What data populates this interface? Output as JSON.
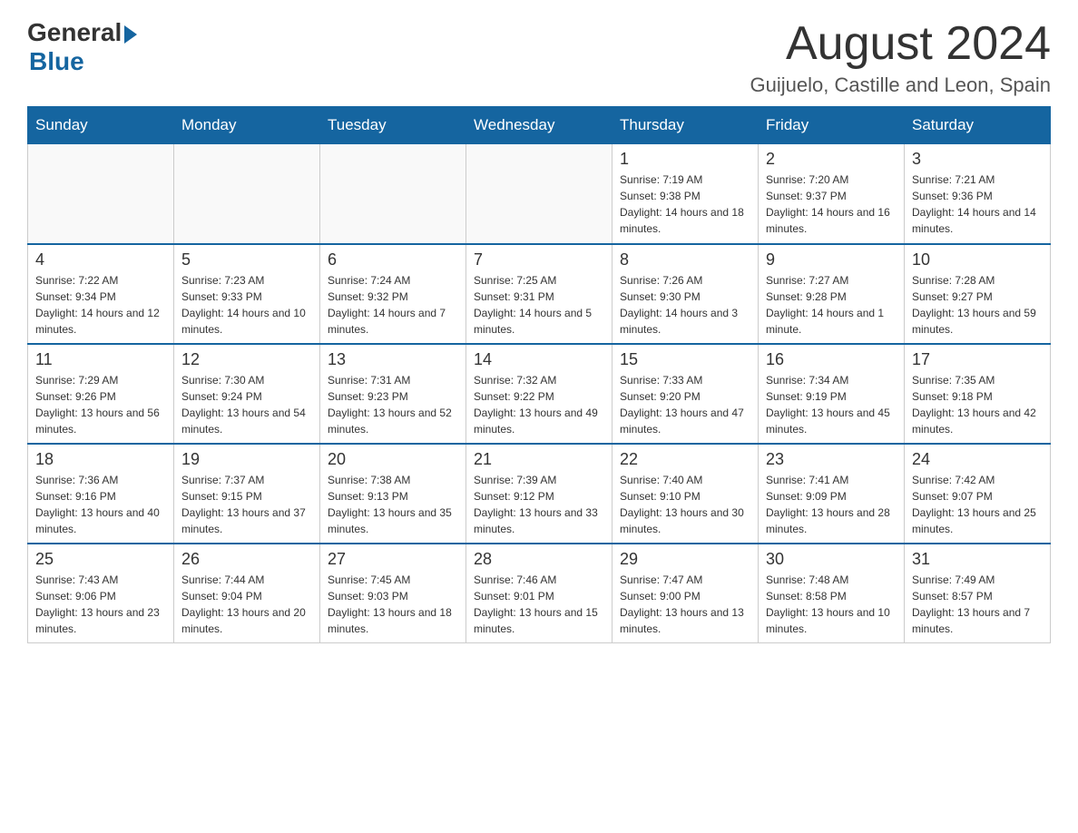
{
  "logo": {
    "general": "General",
    "blue": "Blue"
  },
  "header": {
    "month_year": "August 2024",
    "location": "Guijuelo, Castille and Leon, Spain"
  },
  "days_of_week": [
    "Sunday",
    "Monday",
    "Tuesday",
    "Wednesday",
    "Thursday",
    "Friday",
    "Saturday"
  ],
  "weeks": [
    [
      {
        "day": "",
        "sunrise": "",
        "sunset": "",
        "daylight": ""
      },
      {
        "day": "",
        "sunrise": "",
        "sunset": "",
        "daylight": ""
      },
      {
        "day": "",
        "sunrise": "",
        "sunset": "",
        "daylight": ""
      },
      {
        "day": "",
        "sunrise": "",
        "sunset": "",
        "daylight": ""
      },
      {
        "day": "1",
        "sunrise": "Sunrise: 7:19 AM",
        "sunset": "Sunset: 9:38 PM",
        "daylight": "Daylight: 14 hours and 18 minutes."
      },
      {
        "day": "2",
        "sunrise": "Sunrise: 7:20 AM",
        "sunset": "Sunset: 9:37 PM",
        "daylight": "Daylight: 14 hours and 16 minutes."
      },
      {
        "day": "3",
        "sunrise": "Sunrise: 7:21 AM",
        "sunset": "Sunset: 9:36 PM",
        "daylight": "Daylight: 14 hours and 14 minutes."
      }
    ],
    [
      {
        "day": "4",
        "sunrise": "Sunrise: 7:22 AM",
        "sunset": "Sunset: 9:34 PM",
        "daylight": "Daylight: 14 hours and 12 minutes."
      },
      {
        "day": "5",
        "sunrise": "Sunrise: 7:23 AM",
        "sunset": "Sunset: 9:33 PM",
        "daylight": "Daylight: 14 hours and 10 minutes."
      },
      {
        "day": "6",
        "sunrise": "Sunrise: 7:24 AM",
        "sunset": "Sunset: 9:32 PM",
        "daylight": "Daylight: 14 hours and 7 minutes."
      },
      {
        "day": "7",
        "sunrise": "Sunrise: 7:25 AM",
        "sunset": "Sunset: 9:31 PM",
        "daylight": "Daylight: 14 hours and 5 minutes."
      },
      {
        "day": "8",
        "sunrise": "Sunrise: 7:26 AM",
        "sunset": "Sunset: 9:30 PM",
        "daylight": "Daylight: 14 hours and 3 minutes."
      },
      {
        "day": "9",
        "sunrise": "Sunrise: 7:27 AM",
        "sunset": "Sunset: 9:28 PM",
        "daylight": "Daylight: 14 hours and 1 minute."
      },
      {
        "day": "10",
        "sunrise": "Sunrise: 7:28 AM",
        "sunset": "Sunset: 9:27 PM",
        "daylight": "Daylight: 13 hours and 59 minutes."
      }
    ],
    [
      {
        "day": "11",
        "sunrise": "Sunrise: 7:29 AM",
        "sunset": "Sunset: 9:26 PM",
        "daylight": "Daylight: 13 hours and 56 minutes."
      },
      {
        "day": "12",
        "sunrise": "Sunrise: 7:30 AM",
        "sunset": "Sunset: 9:24 PM",
        "daylight": "Daylight: 13 hours and 54 minutes."
      },
      {
        "day": "13",
        "sunrise": "Sunrise: 7:31 AM",
        "sunset": "Sunset: 9:23 PM",
        "daylight": "Daylight: 13 hours and 52 minutes."
      },
      {
        "day": "14",
        "sunrise": "Sunrise: 7:32 AM",
        "sunset": "Sunset: 9:22 PM",
        "daylight": "Daylight: 13 hours and 49 minutes."
      },
      {
        "day": "15",
        "sunrise": "Sunrise: 7:33 AM",
        "sunset": "Sunset: 9:20 PM",
        "daylight": "Daylight: 13 hours and 47 minutes."
      },
      {
        "day": "16",
        "sunrise": "Sunrise: 7:34 AM",
        "sunset": "Sunset: 9:19 PM",
        "daylight": "Daylight: 13 hours and 45 minutes."
      },
      {
        "day": "17",
        "sunrise": "Sunrise: 7:35 AM",
        "sunset": "Sunset: 9:18 PM",
        "daylight": "Daylight: 13 hours and 42 minutes."
      }
    ],
    [
      {
        "day": "18",
        "sunrise": "Sunrise: 7:36 AM",
        "sunset": "Sunset: 9:16 PM",
        "daylight": "Daylight: 13 hours and 40 minutes."
      },
      {
        "day": "19",
        "sunrise": "Sunrise: 7:37 AM",
        "sunset": "Sunset: 9:15 PM",
        "daylight": "Daylight: 13 hours and 37 minutes."
      },
      {
        "day": "20",
        "sunrise": "Sunrise: 7:38 AM",
        "sunset": "Sunset: 9:13 PM",
        "daylight": "Daylight: 13 hours and 35 minutes."
      },
      {
        "day": "21",
        "sunrise": "Sunrise: 7:39 AM",
        "sunset": "Sunset: 9:12 PM",
        "daylight": "Daylight: 13 hours and 33 minutes."
      },
      {
        "day": "22",
        "sunrise": "Sunrise: 7:40 AM",
        "sunset": "Sunset: 9:10 PM",
        "daylight": "Daylight: 13 hours and 30 minutes."
      },
      {
        "day": "23",
        "sunrise": "Sunrise: 7:41 AM",
        "sunset": "Sunset: 9:09 PM",
        "daylight": "Daylight: 13 hours and 28 minutes."
      },
      {
        "day": "24",
        "sunrise": "Sunrise: 7:42 AM",
        "sunset": "Sunset: 9:07 PM",
        "daylight": "Daylight: 13 hours and 25 minutes."
      }
    ],
    [
      {
        "day": "25",
        "sunrise": "Sunrise: 7:43 AM",
        "sunset": "Sunset: 9:06 PM",
        "daylight": "Daylight: 13 hours and 23 minutes."
      },
      {
        "day": "26",
        "sunrise": "Sunrise: 7:44 AM",
        "sunset": "Sunset: 9:04 PM",
        "daylight": "Daylight: 13 hours and 20 minutes."
      },
      {
        "day": "27",
        "sunrise": "Sunrise: 7:45 AM",
        "sunset": "Sunset: 9:03 PM",
        "daylight": "Daylight: 13 hours and 18 minutes."
      },
      {
        "day": "28",
        "sunrise": "Sunrise: 7:46 AM",
        "sunset": "Sunset: 9:01 PM",
        "daylight": "Daylight: 13 hours and 15 minutes."
      },
      {
        "day": "29",
        "sunrise": "Sunrise: 7:47 AM",
        "sunset": "Sunset: 9:00 PM",
        "daylight": "Daylight: 13 hours and 13 minutes."
      },
      {
        "day": "30",
        "sunrise": "Sunrise: 7:48 AM",
        "sunset": "Sunset: 8:58 PM",
        "daylight": "Daylight: 13 hours and 10 minutes."
      },
      {
        "day": "31",
        "sunrise": "Sunrise: 7:49 AM",
        "sunset": "Sunset: 8:57 PM",
        "daylight": "Daylight: 13 hours and 7 minutes."
      }
    ]
  ]
}
